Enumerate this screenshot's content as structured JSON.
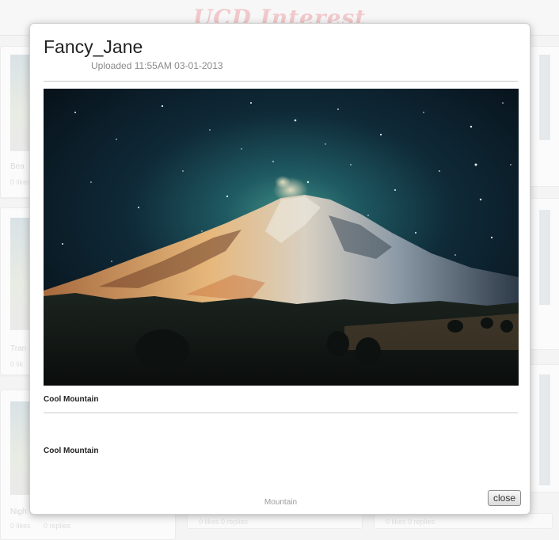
{
  "background": {
    "site_title": "UCD Interest",
    "cards": [
      {
        "title": "Bea",
        "likes": "0 likes",
        "replies": ""
      },
      {
        "title": "Tran",
        "likes": "0 lik",
        "replies": ""
      },
      {
        "title": "Nigh",
        "likes": "0 likes",
        "replies": "0 replies"
      }
    ],
    "bottom_bars": [
      "0 likes 0 replies",
      "0 likes 0 replies"
    ]
  },
  "modal": {
    "username": "Fancy_Jane",
    "uploaded": "Uploaded 11:55AM 03-01-2013",
    "photo_alt": "Cool Mountain",
    "caption": "Cool Mountain",
    "description": "Cool Mountain",
    "tag": "Mountain",
    "close_label": "close"
  }
}
